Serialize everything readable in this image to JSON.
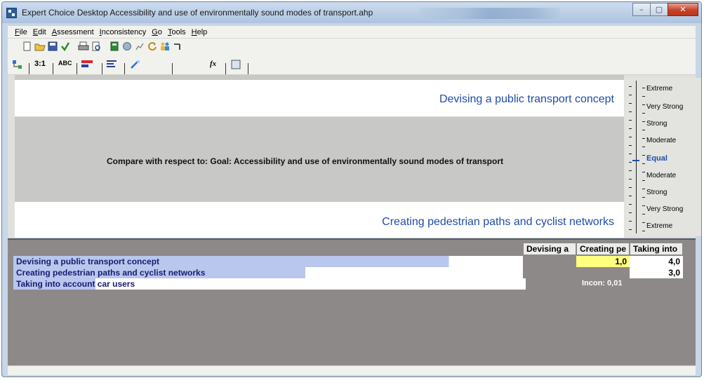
{
  "window": {
    "title": "Expert Choice Desktop    Accessibility and use of environmentally sound modes of transport.ahp",
    "controls": {
      "minimize": "–",
      "maximize": "▢",
      "close": "✕"
    }
  },
  "menu": {
    "items": [
      {
        "label": "File"
      },
      {
        "label": "Edit"
      },
      {
        "label": "Assessment"
      },
      {
        "label": "Inconsistency"
      },
      {
        "label": "Go"
      },
      {
        "label": "Tools"
      },
      {
        "label": "Help"
      }
    ]
  },
  "toolbar2": {
    "ratio_label": "3:1",
    "abc_label": "ABC",
    "fx_label": "fx"
  },
  "comparison": {
    "element_top": "Devising a public transport concept",
    "element_bottom": "Creating pedestrian paths and cyclist networks",
    "compare_text": "Compare with respect to: Goal: Accessibility and use of environmentally sound modes of transport"
  },
  "scale": {
    "labels": [
      "Extreme",
      "Very Strong",
      "Strong",
      "Moderate",
      "Equal",
      "Moderate",
      "Strong",
      "Very Strong",
      "Extreme"
    ],
    "selected_index": 4
  },
  "matrix": {
    "headers": [
      "Devising a",
      "Creating pe",
      "Taking into"
    ],
    "rows": [
      {
        "label": "Devising a public transport concept"
      },
      {
        "label": "Creating pedestrian paths and cyclist networks"
      },
      {
        "label": "Taking into account car users"
      }
    ],
    "cells": {
      "r1c2": "1,0",
      "r1c3": "4,0",
      "r2c3": "3,0"
    },
    "inconsistency": "Incon: 0,01"
  },
  "colors": {
    "element_text": "#1f4da6",
    "highlight_cell": "#ffff80",
    "row_highlight": "#b9c7ee",
    "matrix_background": "#8e8989"
  },
  "icons": {
    "toolbar1": [
      "new-file-icon",
      "open-folder-icon",
      "save-icon",
      "check-icon",
      "print-icon",
      "print-preview-icon",
      "calculator-icon",
      "globe-icon",
      "graph-icon",
      "refresh-icon",
      "people-icon",
      "formula-icon"
    ],
    "toolbar2": [
      "tree-icon",
      "ratio-icon",
      "abc-icon",
      "bar-graph-icon",
      "list-icon",
      "wand-icon",
      "fx-icon",
      "grid-icon"
    ]
  }
}
